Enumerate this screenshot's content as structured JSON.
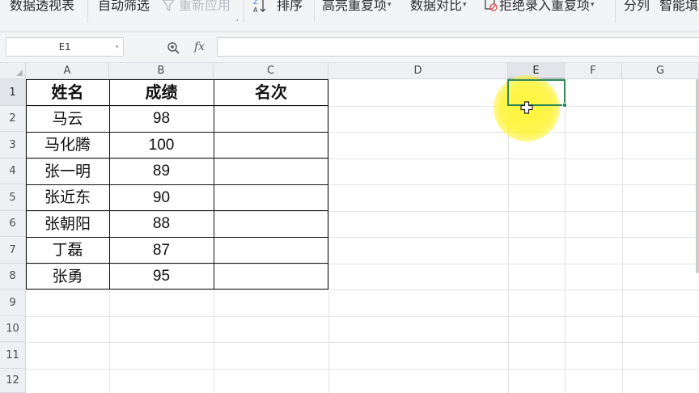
{
  "ribbon": {
    "pivot_table": "数据透视表",
    "auto_filter": "自动筛选",
    "reapply": "重新应用",
    "sort": "排序",
    "highlight_duplicates": "高亮重复项",
    "data_compare": "数据对比",
    "reject_duplicates": "拒绝录入重复项",
    "split": "分列",
    "smart": "智能填"
  },
  "formula_bar": {
    "cell_ref": "E1",
    "fx_label": "fx",
    "formula": ""
  },
  "columns": [
    "A",
    "B",
    "C",
    "D",
    "E",
    "F",
    "G"
  ],
  "selected_column": "E",
  "rows": [
    "1",
    "2",
    "3",
    "4",
    "5",
    "6",
    "7",
    "8",
    "9",
    "10",
    "11",
    "12"
  ],
  "selected_row": "1",
  "table": {
    "headers": [
      "姓名",
      "成绩",
      "名次"
    ],
    "records": [
      {
        "name": "马云",
        "score": "98",
        "rank": ""
      },
      {
        "name": "马化腾",
        "score": "100",
        "rank": ""
      },
      {
        "name": "张一明",
        "score": "89",
        "rank": ""
      },
      {
        "name": "张近东",
        "score": "90",
        "rank": ""
      },
      {
        "name": "张朝阳",
        "score": "88",
        "rank": ""
      },
      {
        "name": "丁磊",
        "score": "87",
        "rank": ""
      },
      {
        "name": "张勇",
        "score": "95",
        "rank": ""
      }
    ]
  },
  "colors": {
    "selection": "#2e8b57",
    "highlight": "#fff528",
    "disabled_text": "#b9bdc3"
  }
}
